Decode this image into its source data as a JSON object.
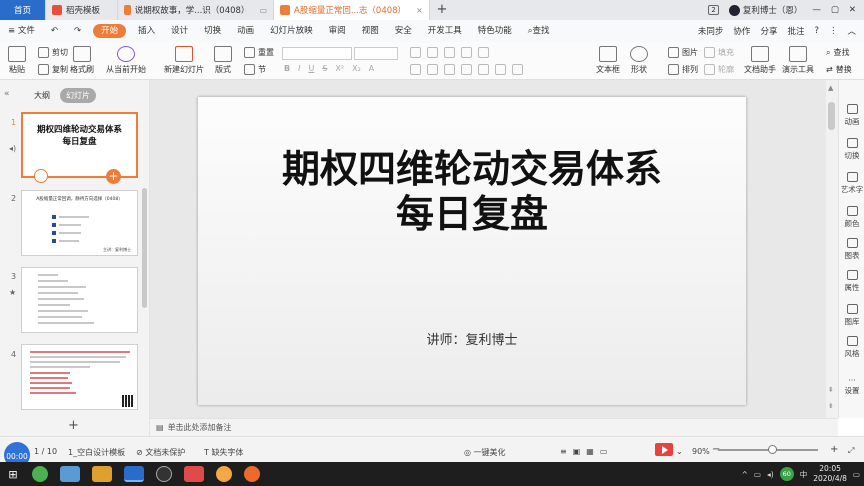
{
  "tabs": {
    "home": "首页",
    "items": [
      {
        "label": "稻壳模板",
        "color": "#e84d3d"
      },
      {
        "label": "说期权故事，学...识（0408）",
        "color": "#f07c3a"
      },
      {
        "label": "A股缩量正常回...志（0408）",
        "color": "#f07c3a"
      }
    ],
    "new_tab": "+",
    "count": "2",
    "user": "复利博士（恩）",
    "close": "×"
  },
  "menu": {
    "file": "≡ 文件",
    "items": [
      "开始",
      "插入",
      "设计",
      "切换",
      "动画",
      "幻灯片放映",
      "审阅",
      "视图",
      "安全",
      "开发工具",
      "特色功能"
    ],
    "search": "查找",
    "right": [
      "未同步",
      "协作",
      "分享",
      "批注"
    ]
  },
  "ribbon": {
    "paste": "粘贴",
    "cut": "剪切",
    "copy": "复制",
    "format_painter": "格式刷",
    "play_from_current": "从当前开始",
    "new_slide": "新建幻灯片",
    "layout": "版式",
    "section": "节",
    "reset": "重置",
    "textbox": "文本框",
    "shape": "形状",
    "image": "图片",
    "arrange": "排列",
    "fill": "填充",
    "outline": "轮廓",
    "doc_assistant": "文档助手",
    "presenter_tools": "演示工具",
    "find": "查找",
    "replace": "替换"
  },
  "leftpanel": {
    "outline_tab": "大纲",
    "slides_tab": "幻灯片",
    "slides": [
      {
        "num": "1",
        "title": "期权四维轮动交易体系\n每日复盘"
      },
      {
        "num": "2",
        "title": "A股缩量正常回调，静待方向选择（0408）",
        "author": "主讲：复利博士"
      },
      {
        "num": "3"
      },
      {
        "num": "4"
      }
    ],
    "add": "+"
  },
  "slide": {
    "title_line1": "期权四维轮动交易体系",
    "title_line2": "每日复盘",
    "author": "讲师：复利博士"
  },
  "rightpanel": [
    "动画",
    "切换",
    "艺术字",
    "颜色",
    "图表",
    "属性",
    "图库",
    "风格",
    "设置"
  ],
  "notes_placeholder": "单击此处添加备注",
  "status": {
    "timer": "00:00",
    "page": "1 / 10",
    "template": "1_空白设计模板",
    "doc_protect": "文档未保护",
    "missing_fonts": "缺失字体",
    "beautify": "一键美化",
    "zoom": "90%",
    "zoom_minus": "−",
    "zoom_plus": "+"
  },
  "taskbar": {
    "time": "20:05",
    "date": "2020/4/8",
    "ime": "中",
    "tray_badge": "60"
  }
}
